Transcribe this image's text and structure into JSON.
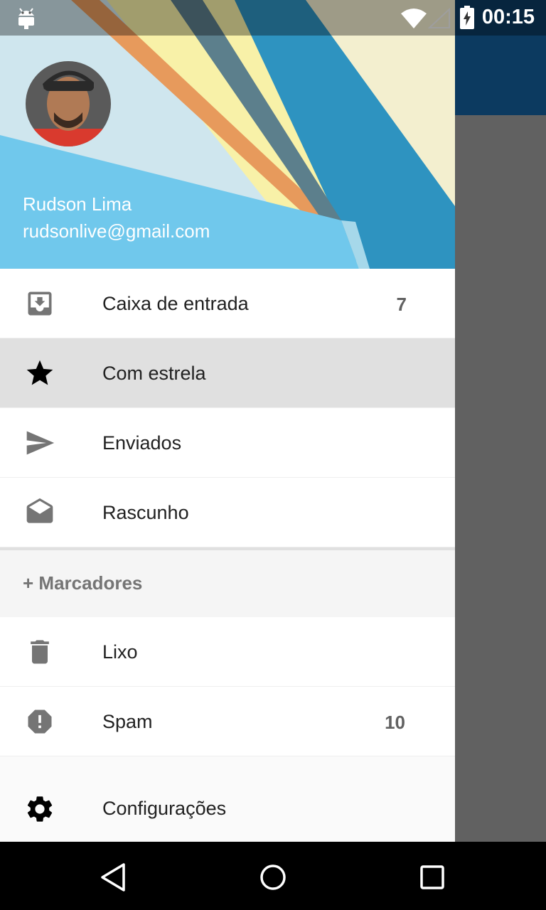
{
  "status_bar": {
    "time": "00:15"
  },
  "account": {
    "name": "Rudson Lima",
    "email": "rudsonlive@gmail.com"
  },
  "menu": [
    {
      "label": "Caixa de entrada",
      "count": "7",
      "icon": "inbox-icon",
      "selected": false
    },
    {
      "label": "Com estrela",
      "count": "",
      "icon": "star-icon",
      "selected": true
    },
    {
      "label": "Enviados",
      "count": "",
      "icon": "send-icon",
      "selected": false
    },
    {
      "label": "Rascunho",
      "count": "",
      "icon": "drafts-icon",
      "selected": false
    }
  ],
  "labels_section": {
    "label": "+ Marcadores"
  },
  "menu2": [
    {
      "label": "Lixo",
      "count": "",
      "icon": "trash-icon"
    },
    {
      "label": "Spam",
      "count": "10",
      "icon": "spam-icon"
    }
  ],
  "settings": {
    "label": "Configurações",
    "icon": "gear-icon"
  },
  "colors": {
    "header_light": "#70c8ec",
    "header_dark": "#2e93c0",
    "accent_orange": "#e79a5c",
    "accent_yellow": "#f8f1a8",
    "app_bar": "#0c3a60"
  }
}
